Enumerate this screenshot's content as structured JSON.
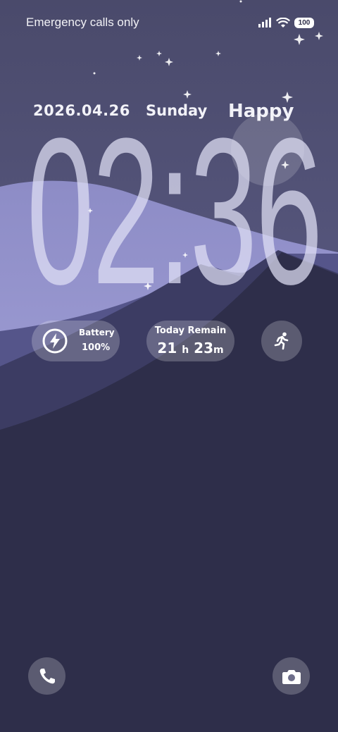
{
  "status_bar": {
    "carrier_text": "Emergency calls only",
    "battery_level": "100",
    "signal_icon": "signal-icon",
    "wifi_icon": "wifi-icon"
  },
  "lock_screen": {
    "date": "2026.04.26",
    "weekday": "Sunday",
    "mood": "Happy",
    "clock_time": "02:36"
  },
  "widgets": {
    "battery": {
      "label": "Battery",
      "value": "100%",
      "icon": "lightning-icon"
    },
    "today_remain": {
      "label": "Today Remain",
      "hours": "21",
      "hours_unit": "h",
      "minutes": "23",
      "minutes_unit": "m"
    },
    "activity": {
      "icon": "running-person-icon"
    }
  },
  "shortcuts": {
    "left_icon": "phone-icon",
    "right_icon": "camera-icon"
  },
  "colors": {
    "sky_top": "#4b4b6e",
    "sky_bottom": "#6a6a99",
    "hill_light": "#a9a8dc",
    "hill_mid": "#3b3b62",
    "ground": "#2e2e4a",
    "widget_bg": "rgba(255,255,255,0.22)"
  }
}
